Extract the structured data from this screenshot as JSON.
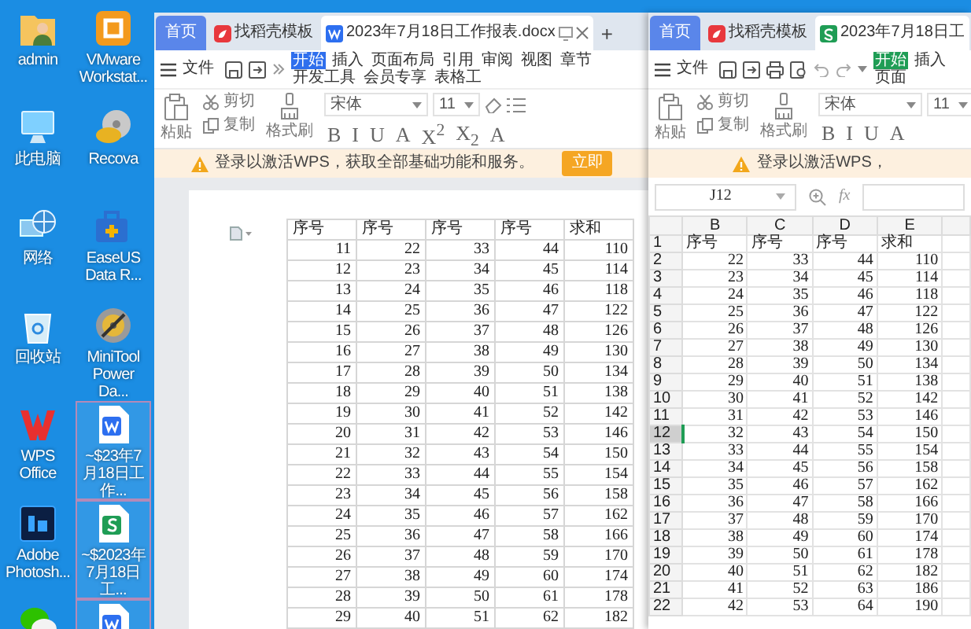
{
  "desktop": {
    "icons": [
      {
        "kind": "user",
        "label": "admin",
        "selected": false
      },
      {
        "kind": "vm",
        "label": "VMware Workstat...",
        "selected": false
      },
      {
        "kind": "computer",
        "label": "此电脑",
        "selected": false
      },
      {
        "kind": "recovery",
        "label": "Recova",
        "selected": false
      },
      {
        "kind": "network",
        "label": "网络",
        "selected": false
      },
      {
        "kind": "toolbox",
        "label": "EaseUS Data R...",
        "selected": false
      },
      {
        "kind": "recycle",
        "label": "回收站",
        "selected": false
      },
      {
        "kind": "disk",
        "label": "MiniTool Power Da...",
        "selected": false
      },
      {
        "kind": "wps",
        "label": "WPS Office",
        "selected": false
      },
      {
        "kind": "word",
        "label": "~$23年7月18日工作...",
        "selected": true
      },
      {
        "kind": "photoshop",
        "label": "Adobe Photosh...",
        "selected": false
      },
      {
        "kind": "spreadsheet",
        "label": "~$2023年7月18日工...",
        "selected": true
      },
      {
        "kind": "chat",
        "selected": false
      },
      {
        "kind": "word",
        "selected": true
      }
    ]
  },
  "windows": [
    {
      "kind": "writer",
      "tabs": [
        {
          "kind": "home",
          "label": "首页",
          "selected": false
        },
        {
          "kind": "template",
          "label": "找稻壳模板",
          "selected": false
        },
        {
          "kind": "document",
          "label": "2023年7月18日工作报表.docx",
          "selected": true
        }
      ],
      "new_tab": "+",
      "file_menu": "文件",
      "ribbon_tabs": [
        {
          "label": "开始",
          "selected": true
        },
        {
          "label": "插入",
          "selected": false
        },
        {
          "label": "页面布局",
          "selected": false
        },
        {
          "label": "引用",
          "selected": false
        },
        {
          "label": "审阅",
          "selected": false
        },
        {
          "label": "视图",
          "selected": false
        },
        {
          "label": "章节",
          "selected": false
        },
        {
          "label": "开发工具",
          "selected": false
        },
        {
          "label": "会员专享",
          "selected": false
        },
        {
          "label": "表格工",
          "selected": false
        }
      ],
      "tools": {
        "paste": "粘贴",
        "cut": "剪切",
        "copy": "复制",
        "format_painter": "格式刷",
        "font": "宋体",
        "size": "11",
        "format_glyphs": [
          "B",
          "I",
          "U",
          "A",
          "X$^{2}$",
          "X$_{2}$",
          "A"
        ]
      },
      "notice": {
        "text": "登录以激活WPS，获取全部基础功能和服务。",
        "button": "立即"
      },
      "table": {
        "columns": [
          "序号",
          "序号",
          "序号",
          "序号",
          "求和"
        ],
        "rows": [
          [
            "11",
            "22",
            "33",
            "44",
            "110"
          ],
          [
            "12",
            "23",
            "34",
            "45",
            "114"
          ],
          [
            "13",
            "24",
            "35",
            "46",
            "118"
          ],
          [
            "14",
            "25",
            "36",
            "47",
            "122"
          ],
          [
            "15",
            "26",
            "37",
            "48",
            "126"
          ],
          [
            "16",
            "27",
            "38",
            "49",
            "130"
          ],
          [
            "17",
            "28",
            "39",
            "50",
            "134"
          ],
          [
            "18",
            "29",
            "40",
            "51",
            "138"
          ],
          [
            "19",
            "30",
            "41",
            "52",
            "142"
          ],
          [
            "20",
            "31",
            "42",
            "53",
            "146"
          ],
          [
            "21",
            "32",
            "43",
            "54",
            "150"
          ],
          [
            "22",
            "33",
            "44",
            "55",
            "154"
          ],
          [
            "23",
            "34",
            "45",
            "56",
            "158"
          ],
          [
            "24",
            "35",
            "46",
            "57",
            "162"
          ],
          [
            "25",
            "36",
            "47",
            "58",
            "166"
          ],
          [
            "26",
            "37",
            "48",
            "59",
            "170"
          ],
          [
            "27",
            "38",
            "49",
            "60",
            "174"
          ],
          [
            "28",
            "39",
            "50",
            "61",
            "178"
          ],
          [
            "29",
            "40",
            "51",
            "62",
            "182"
          ]
        ]
      }
    },
    {
      "kind": "sheet",
      "tabs": [
        {
          "kind": "home",
          "label": "首页",
          "selected": false
        },
        {
          "kind": "template",
          "label": "找稻壳模板",
          "selected": false
        },
        {
          "kind": "spreadsheet",
          "label": "2023年7月18日工",
          "selected": true
        }
      ],
      "file_menu": "文件",
      "ribbon_tabs": [
        {
          "label": "开始",
          "selected": true
        },
        {
          "label": "插入",
          "selected": false
        },
        {
          "label": "页面",
          "selected": false
        }
      ],
      "tools": {
        "paste": "粘贴",
        "cut": "剪切",
        "copy": "复制",
        "format_painter": "格式刷",
        "font": "宋体",
        "size": "11",
        "format_glyphs": [
          "B",
          "I",
          "U",
          "A"
        ]
      },
      "notice": {
        "text": "登录以激活WPS，"
      },
      "name_box": "J12",
      "formula_label": "fx",
      "grid": {
        "columns": [
          "B",
          "C",
          "D",
          "E"
        ],
        "rows": [
          {
            "number": "1",
            "selected": false,
            "cells": [
              "序号",
              "序号",
              "序号",
              "求和"
            ]
          },
          {
            "number": "2",
            "selected": false,
            "cells": [
              "22",
              "33",
              "44",
              "110"
            ]
          },
          {
            "number": "3",
            "selected": false,
            "cells": [
              "23",
              "34",
              "45",
              "114"
            ]
          },
          {
            "number": "4",
            "selected": false,
            "cells": [
              "24",
              "35",
              "46",
              "118"
            ]
          },
          {
            "number": "5",
            "selected": false,
            "cells": [
              "25",
              "36",
              "47",
              "122"
            ]
          },
          {
            "number": "6",
            "selected": false,
            "cells": [
              "26",
              "37",
              "48",
              "126"
            ]
          },
          {
            "number": "7",
            "selected": false,
            "cells": [
              "27",
              "38",
              "49",
              "130"
            ]
          },
          {
            "number": "8",
            "selected": false,
            "cells": [
              "28",
              "39",
              "50",
              "134"
            ]
          },
          {
            "number": "9",
            "selected": false,
            "cells": [
              "29",
              "40",
              "51",
              "138"
            ]
          },
          {
            "number": "10",
            "selected": false,
            "cells": [
              "30",
              "41",
              "52",
              "142"
            ]
          },
          {
            "number": "11",
            "selected": false,
            "cells": [
              "31",
              "42",
              "53",
              "146"
            ]
          },
          {
            "number": "12",
            "selected": true,
            "cells": [
              "32",
              "43",
              "54",
              "150"
            ]
          },
          {
            "number": "13",
            "selected": false,
            "cells": [
              "33",
              "44",
              "55",
              "154"
            ]
          },
          {
            "number": "14",
            "selected": false,
            "cells": [
              "34",
              "45",
              "56",
              "158"
            ]
          },
          {
            "number": "15",
            "selected": false,
            "cells": [
              "35",
              "46",
              "57",
              "162"
            ]
          },
          {
            "number": "16",
            "selected": false,
            "cells": [
              "36",
              "47",
              "58",
              "166"
            ]
          },
          {
            "number": "17",
            "selected": false,
            "cells": [
              "37",
              "48",
              "59",
              "170"
            ]
          },
          {
            "number": "18",
            "selected": false,
            "cells": [
              "38",
              "49",
              "60",
              "174"
            ]
          },
          {
            "number": "19",
            "selected": false,
            "cells": [
              "39",
              "50",
              "61",
              "178"
            ]
          },
          {
            "number": "20",
            "selected": false,
            "cells": [
              "40",
              "51",
              "62",
              "182"
            ]
          },
          {
            "number": "21",
            "selected": false,
            "cells": [
              "41",
              "52",
              "63",
              "186"
            ]
          },
          {
            "number": "22",
            "selected": false,
            "cells": [
              "42",
              "53",
              "64",
              "190"
            ]
          }
        ]
      }
    }
  ]
}
